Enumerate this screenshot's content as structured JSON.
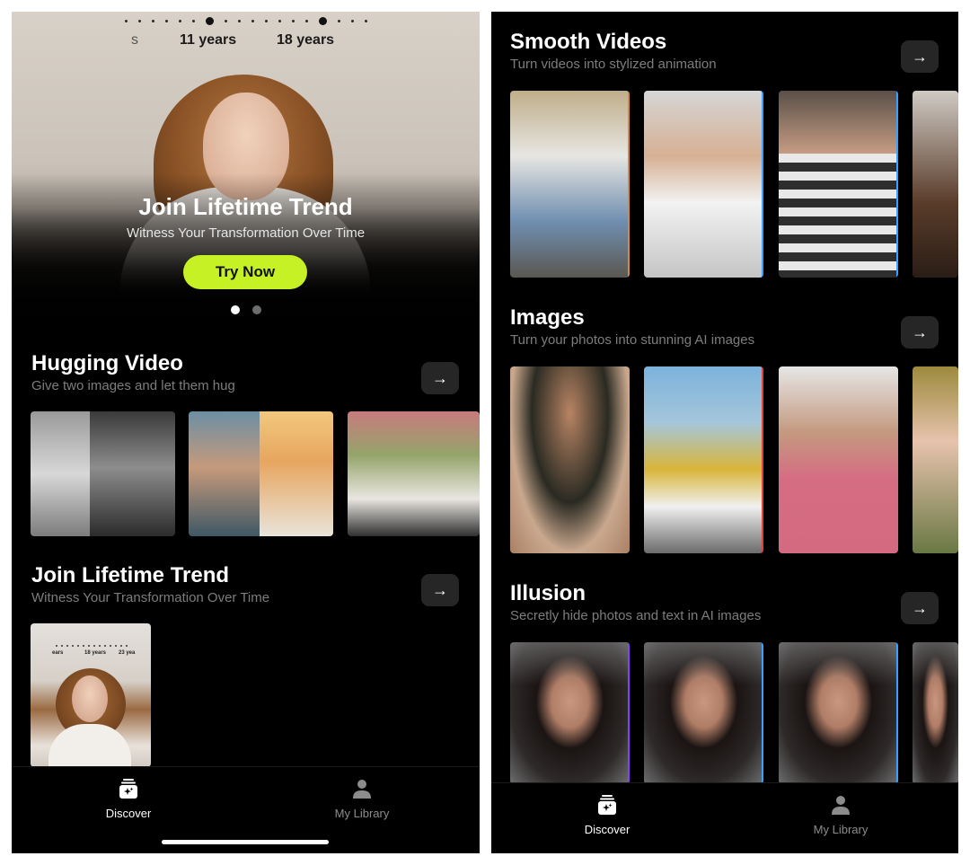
{
  "left": {
    "hero": {
      "year_labels": [
        "s",
        "11 years",
        "18 years"
      ],
      "title": "Join Lifetime Trend",
      "subtitle": "Witness Your Transformation Over Time",
      "cta": "Try Now",
      "pager_count": 2,
      "pager_active": 0
    },
    "sections": [
      {
        "title": "Hugging Video",
        "subtitle": "Give two images and let them hug",
        "arrow": "→"
      },
      {
        "title": "Join Lifetime Trend",
        "subtitle": "Witness Your Transformation Over Time",
        "arrow": "→"
      }
    ],
    "lifetime_thumb_years": [
      "ears",
      "18 years",
      "23 yea"
    ],
    "tabs": [
      {
        "label": "Discover",
        "icon": "discover-icon",
        "active": true
      },
      {
        "label": "My Library",
        "icon": "person-icon",
        "active": false
      }
    ]
  },
  "right": {
    "sections": [
      {
        "title": "Smooth Videos",
        "subtitle": "Turn videos into stylized animation",
        "arrow": "→"
      },
      {
        "title": "Images",
        "subtitle": "Turn your photos into stunning AI images",
        "arrow": "→"
      },
      {
        "title": "Illusion",
        "subtitle": "Secretly hide photos and text in AI images",
        "arrow": "→"
      }
    ],
    "tabs": [
      {
        "label": "Discover",
        "icon": "discover-icon",
        "active": true
      },
      {
        "label": "My Library",
        "icon": "person-icon",
        "active": false
      }
    ]
  },
  "colors": {
    "accent": "#c6f124",
    "background": "#000000",
    "subtitle_gray": "#7d7d7d",
    "arrow_button": "#262626",
    "inactive_tab": "#8c8c8c"
  }
}
